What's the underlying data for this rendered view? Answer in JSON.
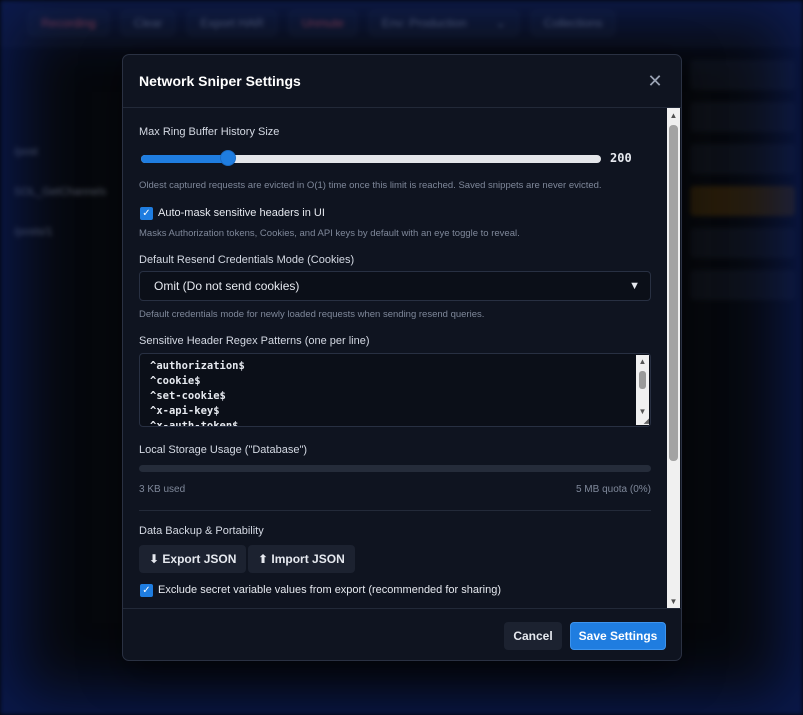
{
  "background": {
    "toolbar": [
      "Recording",
      "Clear",
      "Export HAR",
      "Unmute",
      "Env: Production",
      "Collections"
    ],
    "sidebar": [
      "/post",
      "SOL_GetChannels",
      "/posts/1"
    ]
  },
  "modal": {
    "title": "Network Sniper Settings",
    "close_icon": "close-icon",
    "ring_buffer": {
      "label": "Max Ring Buffer History Size",
      "value": 200,
      "value_text": "200",
      "fraction": 0.19,
      "hint": "Oldest captured requests are evicted in O(1) time once this limit is reached. Saved snippets are never evicted."
    },
    "auto_mask": {
      "checked": true,
      "label": "Auto-mask sensitive headers in UI",
      "hint": "Masks Authorization tokens, Cookies, and API keys by default with an eye toggle to reveal."
    },
    "credentials": {
      "label": "Default Resend Credentials Mode (Cookies)",
      "selected": "Omit (Do not send cookies)",
      "hint": "Default credentials mode for newly loaded requests when sending resend queries."
    },
    "regex": {
      "label": "Sensitive Header Regex Patterns (one per line)",
      "lines": [
        "^authorization$",
        "^cookie$",
        "^set-cookie$",
        "^x-api-key$",
        "^x-auth-token$"
      ]
    },
    "storage": {
      "label": "Local Storage Usage (\"Database\")",
      "used": "3 KB used",
      "quota": "5 MB quota (0%)",
      "fraction": 0.0
    },
    "backup": {
      "label": "Data Backup & Portability",
      "export_label": "⬇ Export JSON",
      "import_label": "⬆ Import JSON",
      "exclude_checked": true,
      "exclude_label": "Exclude secret variable values from export (recommended for sharing)"
    },
    "footer": {
      "cancel_label": "Cancel",
      "save_label": "Save Settings"
    }
  },
  "colors": {
    "accent": "#1f7de0",
    "modal_bg": "#0f1420"
  }
}
